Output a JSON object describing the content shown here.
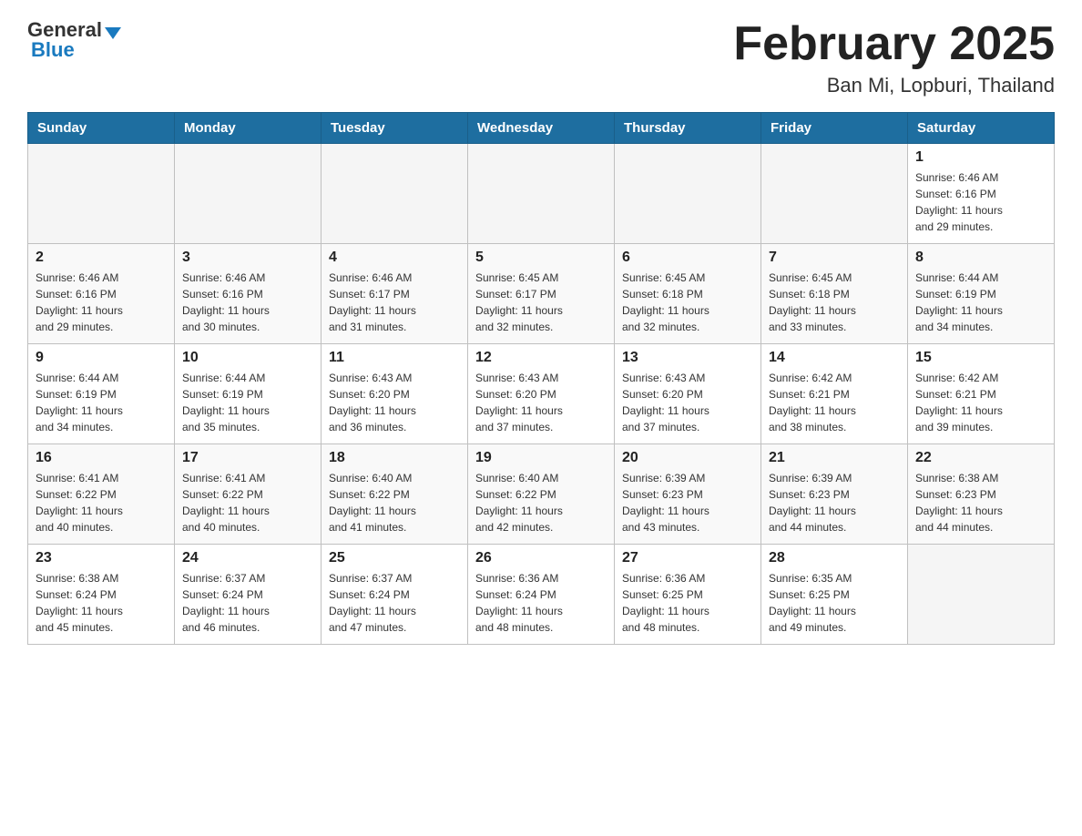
{
  "header": {
    "logo_general": "General",
    "logo_blue": "Blue",
    "main_title": "February 2025",
    "subtitle": "Ban Mi, Lopburi, Thailand"
  },
  "days_of_week": [
    "Sunday",
    "Monday",
    "Tuesday",
    "Wednesday",
    "Thursday",
    "Friday",
    "Saturday"
  ],
  "weeks": [
    [
      {
        "day": "",
        "info": ""
      },
      {
        "day": "",
        "info": ""
      },
      {
        "day": "",
        "info": ""
      },
      {
        "day": "",
        "info": ""
      },
      {
        "day": "",
        "info": ""
      },
      {
        "day": "",
        "info": ""
      },
      {
        "day": "1",
        "info": "Sunrise: 6:46 AM\nSunset: 6:16 PM\nDaylight: 11 hours\nand 29 minutes."
      }
    ],
    [
      {
        "day": "2",
        "info": "Sunrise: 6:46 AM\nSunset: 6:16 PM\nDaylight: 11 hours\nand 29 minutes."
      },
      {
        "day": "3",
        "info": "Sunrise: 6:46 AM\nSunset: 6:16 PM\nDaylight: 11 hours\nand 30 minutes."
      },
      {
        "day": "4",
        "info": "Sunrise: 6:46 AM\nSunset: 6:17 PM\nDaylight: 11 hours\nand 31 minutes."
      },
      {
        "day": "5",
        "info": "Sunrise: 6:45 AM\nSunset: 6:17 PM\nDaylight: 11 hours\nand 32 minutes."
      },
      {
        "day": "6",
        "info": "Sunrise: 6:45 AM\nSunset: 6:18 PM\nDaylight: 11 hours\nand 32 minutes."
      },
      {
        "day": "7",
        "info": "Sunrise: 6:45 AM\nSunset: 6:18 PM\nDaylight: 11 hours\nand 33 minutes."
      },
      {
        "day": "8",
        "info": "Sunrise: 6:44 AM\nSunset: 6:19 PM\nDaylight: 11 hours\nand 34 minutes."
      }
    ],
    [
      {
        "day": "9",
        "info": "Sunrise: 6:44 AM\nSunset: 6:19 PM\nDaylight: 11 hours\nand 34 minutes."
      },
      {
        "day": "10",
        "info": "Sunrise: 6:44 AM\nSunset: 6:19 PM\nDaylight: 11 hours\nand 35 minutes."
      },
      {
        "day": "11",
        "info": "Sunrise: 6:43 AM\nSunset: 6:20 PM\nDaylight: 11 hours\nand 36 minutes."
      },
      {
        "day": "12",
        "info": "Sunrise: 6:43 AM\nSunset: 6:20 PM\nDaylight: 11 hours\nand 37 minutes."
      },
      {
        "day": "13",
        "info": "Sunrise: 6:43 AM\nSunset: 6:20 PM\nDaylight: 11 hours\nand 37 minutes."
      },
      {
        "day": "14",
        "info": "Sunrise: 6:42 AM\nSunset: 6:21 PM\nDaylight: 11 hours\nand 38 minutes."
      },
      {
        "day": "15",
        "info": "Sunrise: 6:42 AM\nSunset: 6:21 PM\nDaylight: 11 hours\nand 39 minutes."
      }
    ],
    [
      {
        "day": "16",
        "info": "Sunrise: 6:41 AM\nSunset: 6:22 PM\nDaylight: 11 hours\nand 40 minutes."
      },
      {
        "day": "17",
        "info": "Sunrise: 6:41 AM\nSunset: 6:22 PM\nDaylight: 11 hours\nand 40 minutes."
      },
      {
        "day": "18",
        "info": "Sunrise: 6:40 AM\nSunset: 6:22 PM\nDaylight: 11 hours\nand 41 minutes."
      },
      {
        "day": "19",
        "info": "Sunrise: 6:40 AM\nSunset: 6:22 PM\nDaylight: 11 hours\nand 42 minutes."
      },
      {
        "day": "20",
        "info": "Sunrise: 6:39 AM\nSunset: 6:23 PM\nDaylight: 11 hours\nand 43 minutes."
      },
      {
        "day": "21",
        "info": "Sunrise: 6:39 AM\nSunset: 6:23 PM\nDaylight: 11 hours\nand 44 minutes."
      },
      {
        "day": "22",
        "info": "Sunrise: 6:38 AM\nSunset: 6:23 PM\nDaylight: 11 hours\nand 44 minutes."
      }
    ],
    [
      {
        "day": "23",
        "info": "Sunrise: 6:38 AM\nSunset: 6:24 PM\nDaylight: 11 hours\nand 45 minutes."
      },
      {
        "day": "24",
        "info": "Sunrise: 6:37 AM\nSunset: 6:24 PM\nDaylight: 11 hours\nand 46 minutes."
      },
      {
        "day": "25",
        "info": "Sunrise: 6:37 AM\nSunset: 6:24 PM\nDaylight: 11 hours\nand 47 minutes."
      },
      {
        "day": "26",
        "info": "Sunrise: 6:36 AM\nSunset: 6:24 PM\nDaylight: 11 hours\nand 48 minutes."
      },
      {
        "day": "27",
        "info": "Sunrise: 6:36 AM\nSunset: 6:25 PM\nDaylight: 11 hours\nand 48 minutes."
      },
      {
        "day": "28",
        "info": "Sunrise: 6:35 AM\nSunset: 6:25 PM\nDaylight: 11 hours\nand 49 minutes."
      },
      {
        "day": "",
        "info": ""
      }
    ]
  ]
}
